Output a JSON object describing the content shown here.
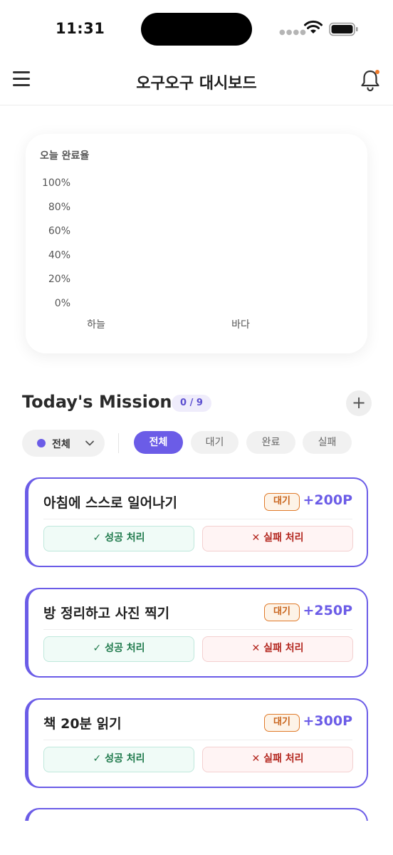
{
  "status_bar": {
    "time": "11:31"
  },
  "header": {
    "title": "오구오구 대시보드"
  },
  "chart_card": {
    "title": "오늘 완료율",
    "chart_data": {
      "type": "bar",
      "categories": [
        "하늘",
        "바다"
      ],
      "values": [
        0,
        0
      ],
      "yticks": [
        "100%",
        "80%",
        "60%",
        "40%",
        "20%",
        "0%"
      ],
      "ylim": [
        0,
        100
      ],
      "grid": false,
      "bar_color": "#6b5ce7"
    }
  },
  "missions": {
    "title": "Today's Missions",
    "count": "0 / 9",
    "add_symbol": "+"
  },
  "filters": {
    "owner_label": "전체",
    "owner_dot_color": "#6b5ce7",
    "status_chips": [
      {
        "label": "전체",
        "active": true
      },
      {
        "label": "대기",
        "active": false
      },
      {
        "label": "완료",
        "active": false
      },
      {
        "label": "실패",
        "active": false
      }
    ]
  },
  "mission_items": [
    {
      "title": "아침에 스스로 일어나기",
      "status": "대기",
      "points": "+200P",
      "success_label": "✓ 성공 처리",
      "fail_label": "✕ 실패 처리"
    },
    {
      "title": "방 정리하고 사진 찍기",
      "status": "대기",
      "points": "+250P",
      "success_label": "✓ 성공 처리",
      "fail_label": "✕ 실패 처리"
    },
    {
      "title": "책 20분 읽기",
      "status": "대기",
      "points": "+300P",
      "success_label": "✓ 성공 처리",
      "fail_label": "✕ 실패 처리"
    }
  ],
  "colors": {
    "accent": "#6b5ce7",
    "pending_status": "#e07a2a",
    "success": "#1f7a4c",
    "fail": "#b3261e",
    "notification_dot": "#f07a2a"
  }
}
